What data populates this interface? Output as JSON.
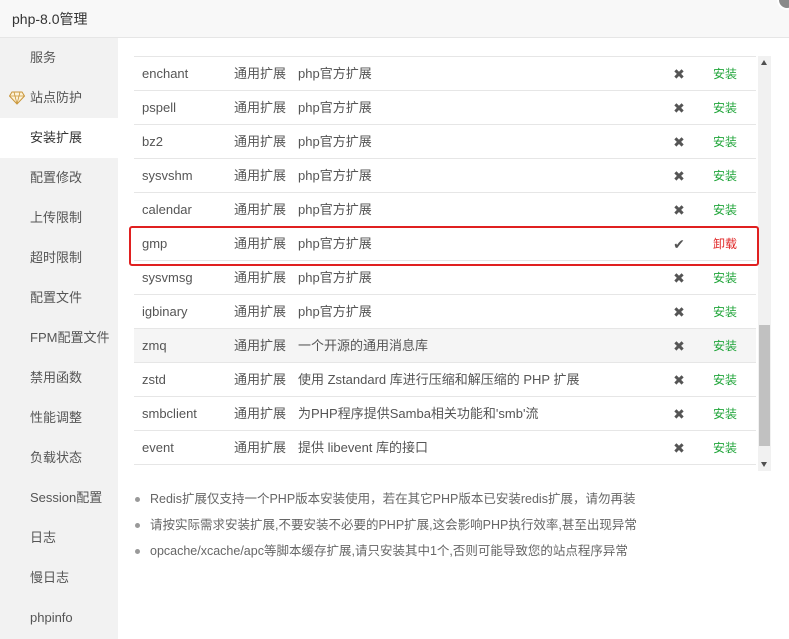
{
  "window": {
    "title": "php-8.0管理"
  },
  "sidebar": {
    "items": [
      {
        "label": "服务",
        "active": false
      },
      {
        "label": "站点防护",
        "active": false,
        "icon": "diamond-icon"
      },
      {
        "label": "安装扩展",
        "active": true
      },
      {
        "label": "配置修改",
        "active": false
      },
      {
        "label": "上传限制",
        "active": false
      },
      {
        "label": "超时限制",
        "active": false
      },
      {
        "label": "配置文件",
        "active": false
      },
      {
        "label": "FPM配置文件",
        "active": false
      },
      {
        "label": "禁用函数",
        "active": false
      },
      {
        "label": "性能调整",
        "active": false
      },
      {
        "label": "负载状态",
        "active": false
      },
      {
        "label": "Session配置",
        "active": false
      },
      {
        "label": "日志",
        "active": false
      },
      {
        "label": "慢日志",
        "active": false
      },
      {
        "label": "phpinfo",
        "active": false
      }
    ]
  },
  "extensions": {
    "rows": [
      {
        "name": "enchant",
        "type": "通用扩展",
        "desc": "php官方扩展",
        "status": "✖",
        "action": "安装",
        "installed": false,
        "shaded": false
      },
      {
        "name": "pspell",
        "type": "通用扩展",
        "desc": "php官方扩展",
        "status": "✖",
        "action": "安装",
        "installed": false,
        "shaded": false
      },
      {
        "name": "bz2",
        "type": "通用扩展",
        "desc": "php官方扩展",
        "status": "✖",
        "action": "安装",
        "installed": false,
        "shaded": false
      },
      {
        "name": "sysvshm",
        "type": "通用扩展",
        "desc": "php官方扩展",
        "status": "✖",
        "action": "安装",
        "installed": false,
        "shaded": false
      },
      {
        "name": "calendar",
        "type": "通用扩展",
        "desc": "php官方扩展",
        "status": "✖",
        "action": "安装",
        "installed": false,
        "shaded": false
      },
      {
        "name": "gmp",
        "type": "通用扩展",
        "desc": "php官方扩展",
        "status": "✔",
        "action": "卸载",
        "installed": true,
        "shaded": false
      },
      {
        "name": "sysvmsg",
        "type": "通用扩展",
        "desc": "php官方扩展",
        "status": "✖",
        "action": "安装",
        "installed": false,
        "shaded": false
      },
      {
        "name": "igbinary",
        "type": "通用扩展",
        "desc": "php官方扩展",
        "status": "✖",
        "action": "安装",
        "installed": false,
        "shaded": false
      },
      {
        "name": "zmq",
        "type": "通用扩展",
        "desc": "一个开源的通用消息库",
        "status": "✖",
        "action": "安装",
        "installed": false,
        "shaded": true
      },
      {
        "name": "zstd",
        "type": "通用扩展",
        "desc": "使用 Zstandard 库进行压缩和解压缩的 PHP 扩展",
        "status": "✖",
        "action": "安装",
        "installed": false,
        "shaded": false
      },
      {
        "name": "smbclient",
        "type": "通用扩展",
        "desc": "为PHP程序提供Samba相关功能和'smb'流",
        "status": "✖",
        "action": "安装",
        "installed": false,
        "shaded": false
      },
      {
        "name": "event",
        "type": "通用扩展",
        "desc": "提供 libevent 库的接口",
        "status": "✖",
        "action": "安装",
        "installed": false,
        "shaded": false
      }
    ]
  },
  "notes": [
    "Redis扩展仅支持一个PHP版本安装使用，若在其它PHP版本已安装redis扩展，请勿再装",
    "请按实际需求安装扩展,不要安装不必要的PHP扩展,这会影响PHP执行效率,甚至出现异常",
    "opcache/xcache/apc等脚本缓存扩展,请只安装其中1个,否则可能导致您的站点程序异常"
  ],
  "colors": {
    "install": "#20a53a",
    "uninstall": "#e02727",
    "highlight": "#e02020"
  }
}
